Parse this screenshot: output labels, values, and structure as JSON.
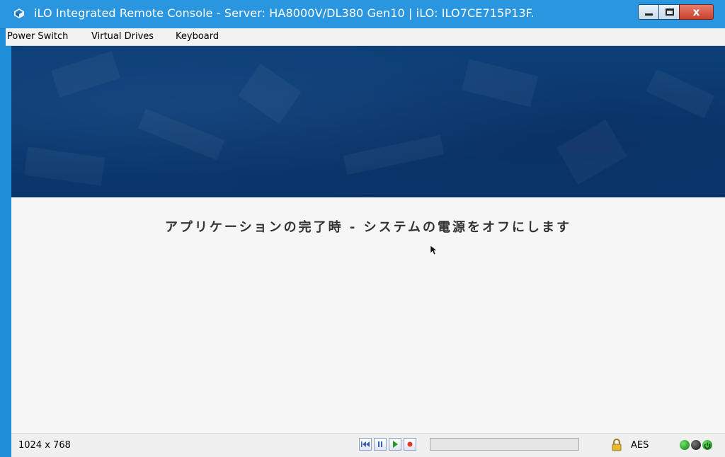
{
  "window": {
    "title": "iLO Integrated Remote Console - Server: HA8000V/DL380 Gen10 | iLO: ILO7CE715P13F.",
    "close_glyph": "x"
  },
  "menu": [
    "Power Switch",
    "Virtual Drives",
    "Keyboard"
  ],
  "console": {
    "message": "アプリケーションの完了時 - システムの電源をオフにします"
  },
  "status": {
    "resolution": "1024 x 768",
    "encryption": "AES",
    "progress": 0,
    "playback_buttons": [
      "skip-to-start-icon",
      "pause-icon",
      "play-icon",
      "record-icon"
    ]
  },
  "colors": {
    "titlebar": "#2a96e0",
    "banner": "#0b3a70",
    "console_bg": "#f6f6f6"
  }
}
